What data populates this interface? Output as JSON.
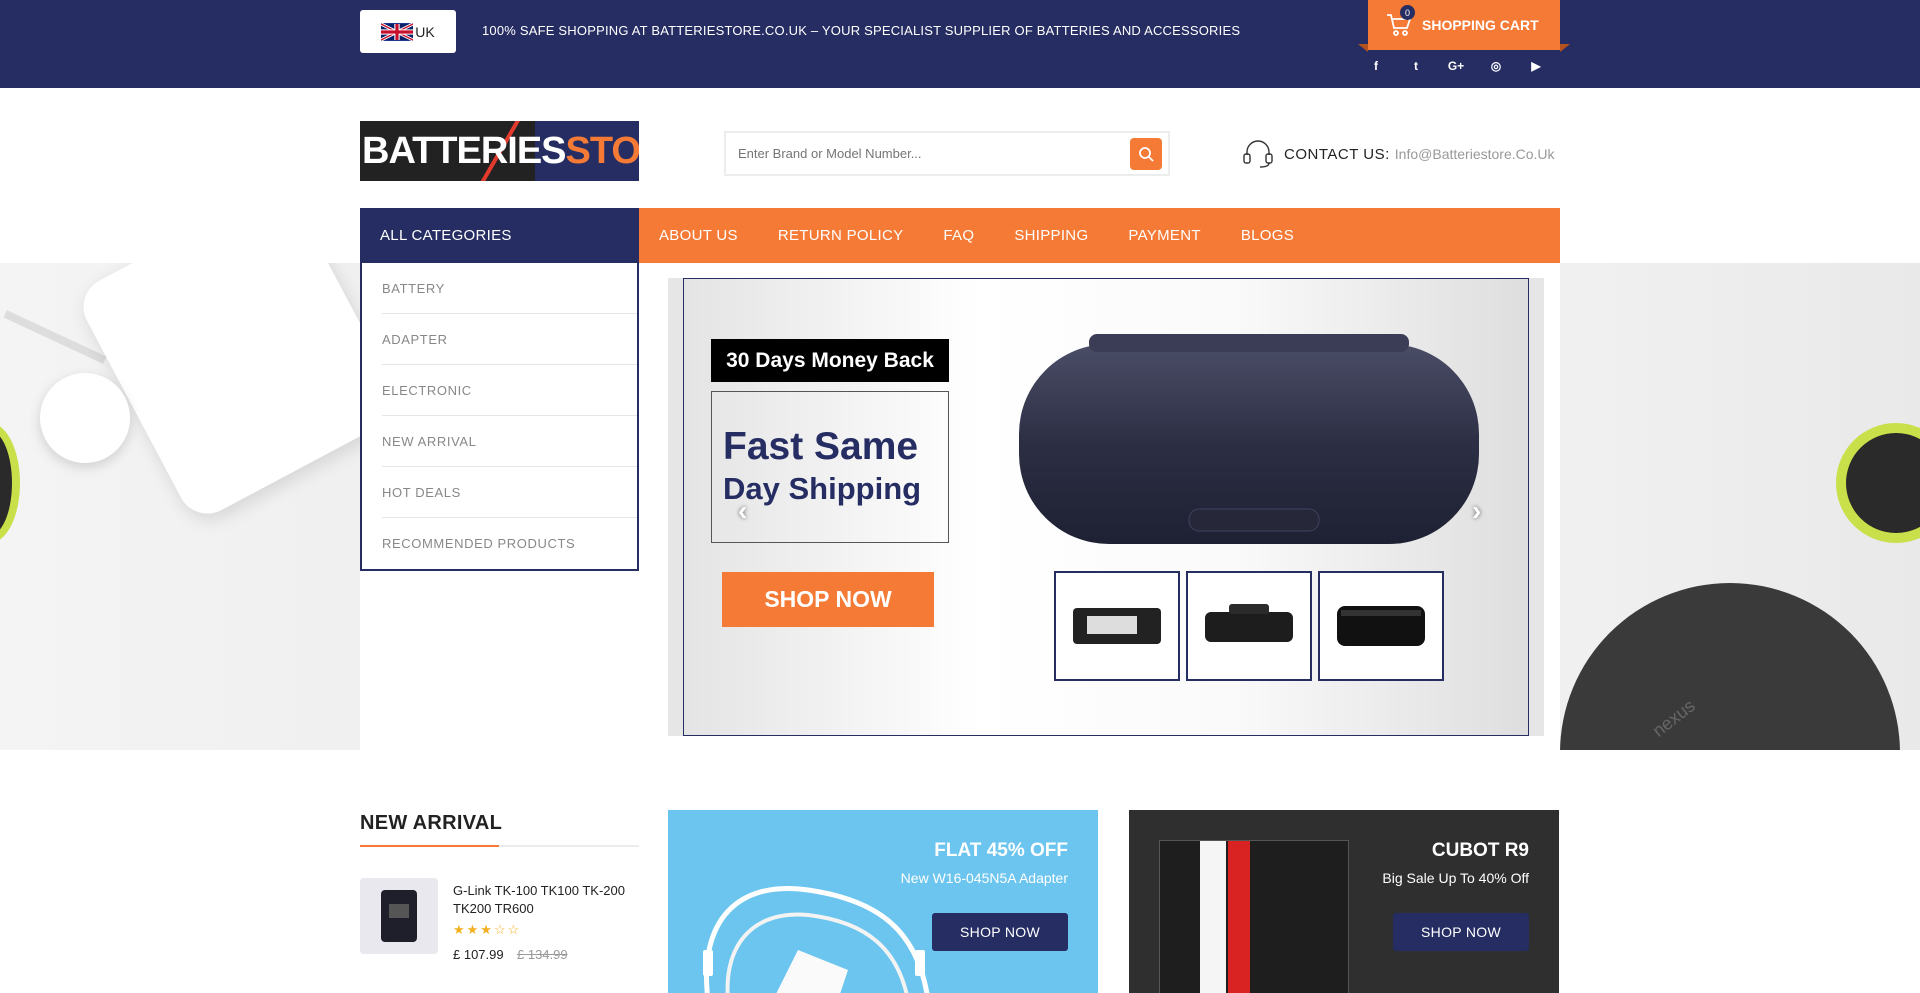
{
  "topbar": {
    "lang_label": "UK",
    "tagline": "100% SAFE SHOPPING AT BATTERIESTORE.CO.UK – YOUR SPECIALIST SUPPLIER OF BATTERIES AND ACCESSORIES",
    "cart_label": "SHOPPING CART",
    "cart_count": "0",
    "socials": [
      "facebook-icon",
      "twitter-icon",
      "google-plus-icon",
      "rss-icon",
      "youtube-icon"
    ],
    "social_glyphs": [
      "f",
      "t",
      "G+",
      "◎",
      "▶"
    ]
  },
  "header": {
    "logo_part1": "BATTERIES",
    "logo_part2": "TORE",
    "logo_mid": "S",
    "search_placeholder": "Enter Brand or Model Number...",
    "contact_label": "CONTACT US:",
    "contact_email": "Info@Batteriestore.Co.Uk"
  },
  "nav": {
    "all_categories": "ALL CATEGORIES",
    "links": [
      "ABOUT US",
      "RETURN POLICY",
      "FAQ",
      "SHIPPING",
      "PAYMENT",
      "BLOGS"
    ]
  },
  "categories": [
    "BATTERY",
    "ADAPTER",
    "ELECTRONIC",
    "NEW ARRIVAL",
    "HOT DEALS",
    "RECOMMENDED PRODUCTS"
  ],
  "slider": {
    "badge": "30 Days Money Back",
    "headline_1": "Fast Same",
    "headline_2": "Day Shipping",
    "cta": "SHOP NOW",
    "prev": "‹",
    "next": "›"
  },
  "hero_decor": {
    "brand_text": "nexus"
  },
  "new_arrival": {
    "title": "NEW ARRIVAL",
    "product": {
      "name": "G-Link TK-100 TK100 TK-200 TK200 TR600",
      "rating": 3,
      "max_rating": 5,
      "stars": "★★★☆☆",
      "price": "£ 107.99",
      "old_price": "£ 134.99"
    }
  },
  "promos": [
    {
      "title": "FLAT 45% OFF",
      "subtitle": "New W16-045N5A Adapter",
      "cta": "SHOP NOW"
    },
    {
      "title": "CUBOT R9",
      "subtitle": "Big Sale Up To 40% Off",
      "cta": "SHOP NOW"
    }
  ],
  "colors": {
    "brand_navy": "#252d63",
    "accent_orange": "#f47a36",
    "promo_blue": "#6cc5ee",
    "promo_dark": "#2f2f2f"
  }
}
